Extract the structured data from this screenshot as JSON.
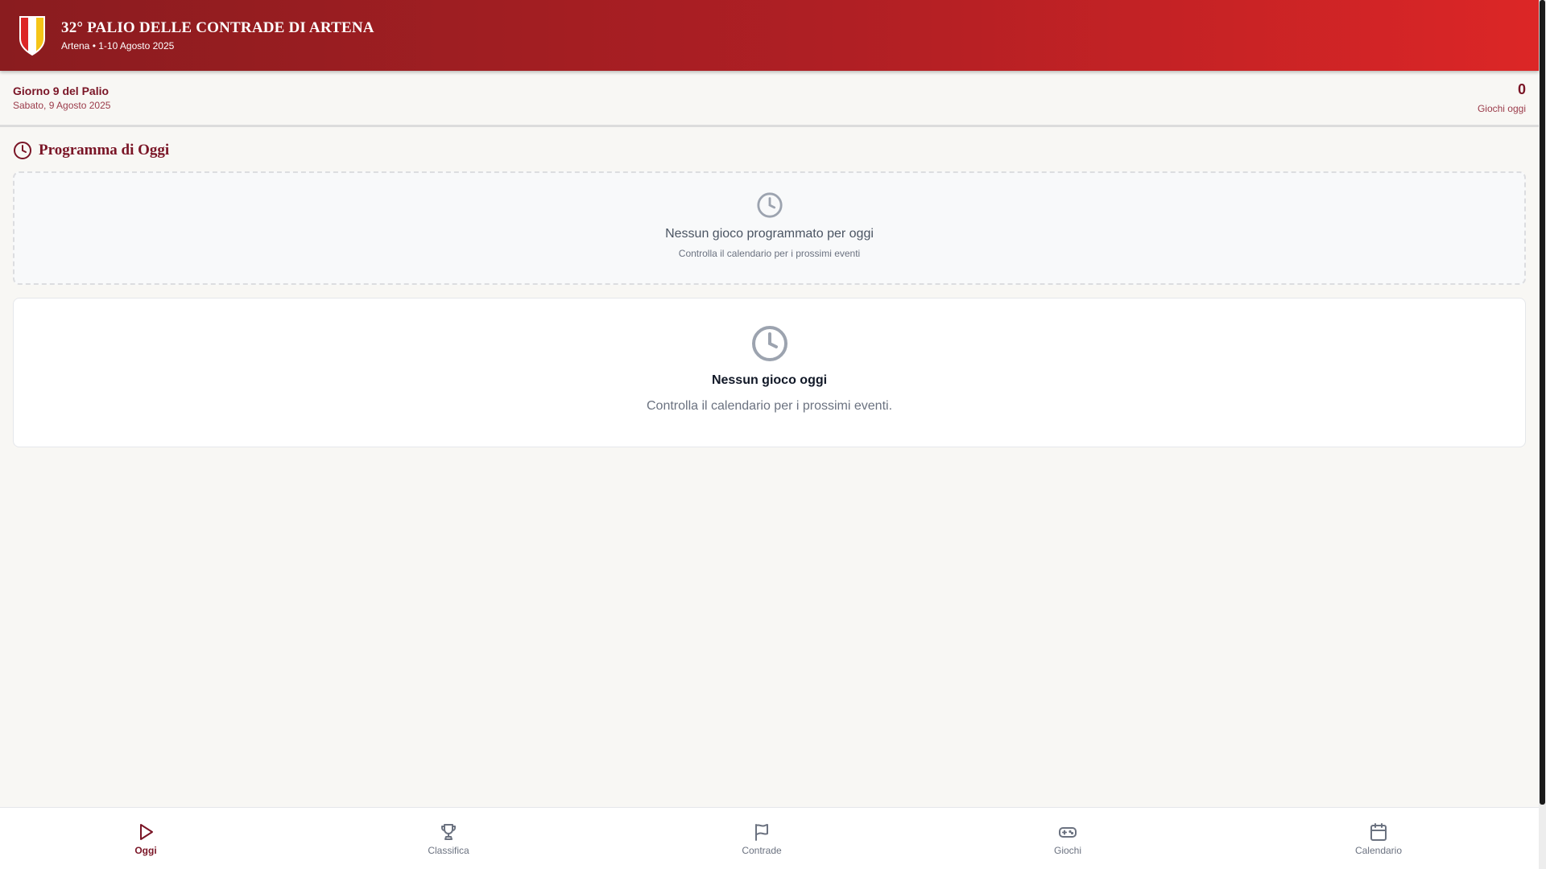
{
  "header": {
    "title": "32° PALIO DELLE CONTRADE DI ARTENA",
    "subtitle": "Artena • 1-10 Agosto 2025",
    "logo_icon": "shield-crest-icon",
    "crest_colors": [
      "#dc2626",
      "#ffffff",
      "#f5c518"
    ]
  },
  "day_bar": {
    "title": "Giorno 9 del Palio",
    "date": "Sabato, 9 Agosto 2025",
    "games_count": "0",
    "games_label": "Giochi oggi"
  },
  "section": {
    "title": "Programma di Oggi",
    "icon": "clock-icon"
  },
  "empty_schedule": {
    "icon": "clock-icon",
    "message": "Nessun gioco programmato per oggi",
    "hint": "Controlla il calendario per i prossimi eventi"
  },
  "empty_today": {
    "icon": "clock-icon",
    "message": "Nessun gioco oggi",
    "hint": "Controlla il calendario per i prossimi eventi."
  },
  "nav": {
    "items": [
      {
        "label": "Oggi",
        "icon": "play-icon",
        "active": true
      },
      {
        "label": "Classifica",
        "icon": "trophy-icon",
        "active": false
      },
      {
        "label": "Contrade",
        "icon": "flag-icon",
        "active": false
      },
      {
        "label": "Giochi",
        "icon": "gamepad-icon",
        "active": false
      },
      {
        "label": "Calendario",
        "icon": "calendar-icon",
        "active": false
      }
    ]
  },
  "colors": {
    "brand": "#7a1526",
    "header_start": "#8a1c1f",
    "header_end": "#dc2626",
    "background": "#f8f7f4"
  }
}
